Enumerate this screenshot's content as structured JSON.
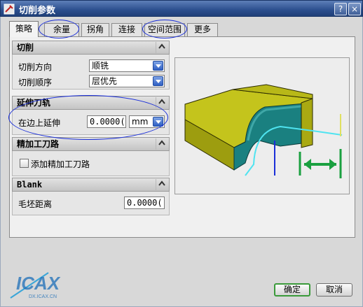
{
  "window": {
    "title": "切削参数",
    "close_glyph": "×"
  },
  "tabs": [
    {
      "label": "策略",
      "active": true
    },
    {
      "label": "余量"
    },
    {
      "label": "拐角"
    },
    {
      "label": "连接"
    },
    {
      "label": "空间范围"
    },
    {
      "label": "更多"
    }
  ],
  "sections": {
    "cutting": {
      "title": "切削",
      "direction_label": "切削方向",
      "direction_value": "顺铣",
      "order_label": "切削顺序",
      "order_value": "层优先"
    },
    "extend": {
      "title": "延伸刀轨",
      "extend_label": "在边上延伸",
      "extend_value": "0.0000(",
      "unit": "mm"
    },
    "finish": {
      "title": "精加工刀路",
      "add_label": "添加精加工刀路",
      "checked": false
    },
    "blank": {
      "title": "Blank",
      "distance_label": "毛坯距离",
      "distance_value": "0.0000("
    }
  },
  "watermark": {
    "logo_text": "ICAX",
    "site": "DX.ICAX.CN"
  },
  "buttons": {
    "ok": "确定",
    "cancel": "取消"
  },
  "colors": {
    "title_bar": "#2c4f8e",
    "part": "#b5b515",
    "wall": "#1f7f7f",
    "toolpath": "#35d6e6",
    "extend_arrow": "#1aa040",
    "oval": "#1a2ed8"
  }
}
